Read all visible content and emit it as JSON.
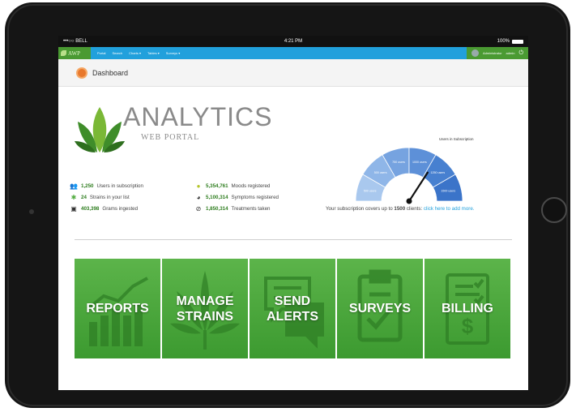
{
  "status_bar": {
    "carrier": "•••○○ BELL",
    "time": "4:21 PM",
    "battery": "100%"
  },
  "navbar": {
    "logo": "AWP",
    "menu": [
      "Portal",
      "Search",
      "Charts ▾",
      "Tables ▾",
      "Surveys ▾"
    ],
    "user": "Administrator",
    "user_role": "admin"
  },
  "breadcrumb": {
    "title": "Dashboard"
  },
  "brand": {
    "title": "ANALYTICS",
    "subtitle": "WEB PORTAL"
  },
  "stats_left": [
    {
      "icon": "users-icon",
      "value": "1,250",
      "label": "Users in subscription"
    },
    {
      "icon": "leaf-icon",
      "value": "24",
      "label": "Strains in your list"
    },
    {
      "icon": "jar-icon",
      "value": "403,398",
      "label": "Grams ingested"
    }
  ],
  "stats_right": [
    {
      "icon": "mood-icon",
      "value": "5,354,761",
      "label": "Moods registered"
    },
    {
      "icon": "head-icon",
      "value": "5,100,314",
      "label": "Symptoms registered"
    },
    {
      "icon": "pill-icon",
      "value": "1,850,314",
      "label": "Treatments taken"
    }
  ],
  "gauge": {
    "title": "Users in Subscription",
    "segments": [
      "500 users",
      "500 users",
      "750 users",
      "1000 users",
      "1250 users",
      "1500 users"
    ],
    "needle_value": 1250,
    "max": 1500,
    "caption_prefix": "Your subscription covers up to",
    "caption_value": "1500",
    "caption_suffix": "clients:",
    "caption_link": "click here to add more."
  },
  "tiles": [
    {
      "lines": [
        "REPORTS"
      ],
      "icon": "chart-icon"
    },
    {
      "lines": [
        "MANAGE",
        "STRAINS"
      ],
      "icon": "cannabis-leaf-icon"
    },
    {
      "lines": [
        "SEND",
        "ALERTS"
      ],
      "icon": "chat-bubbles-icon"
    },
    {
      "lines": [
        "SURVEYS"
      ],
      "icon": "clipboard-icon"
    },
    {
      "lines": [
        "BILLING"
      ],
      "icon": "invoice-icon"
    }
  ],
  "colors": {
    "accent_blue": "#21a0dc",
    "brand_green": "#4a9a32",
    "tile_green": "#4faa3d",
    "gauge_blue": "#3b74c9"
  }
}
